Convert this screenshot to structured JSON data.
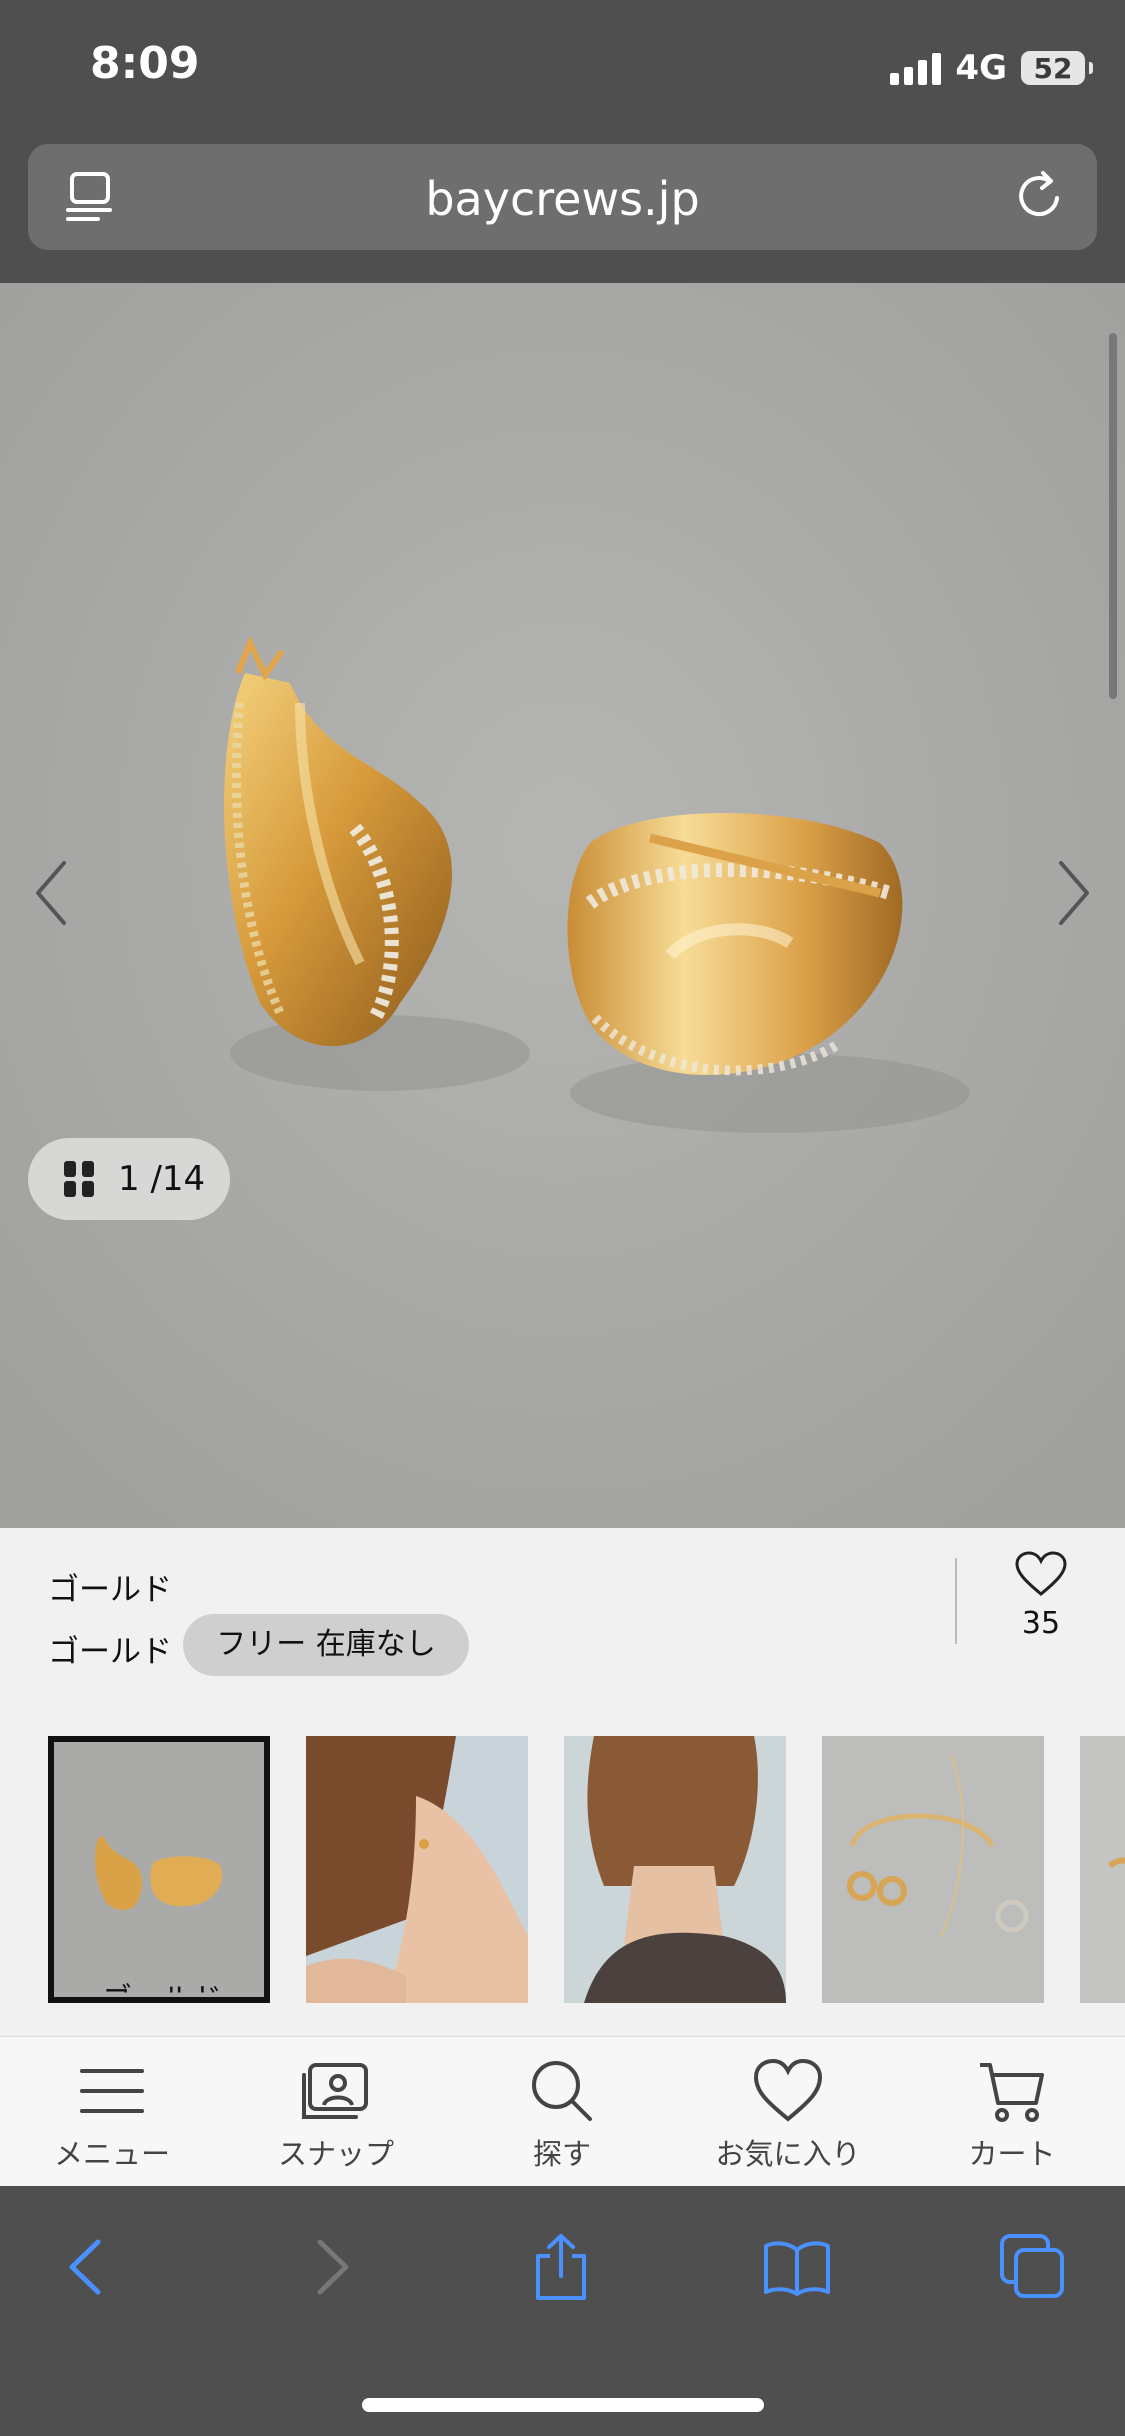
{
  "status_bar": {
    "time": "8:09",
    "network": "4G",
    "battery": "52"
  },
  "url_bar": {
    "domain": "baycrews.jp"
  },
  "gallery": {
    "counter": "1 /14"
  },
  "product": {
    "color_label": "ゴールド",
    "variant_color": "ゴールド",
    "size_stock": "フリー 在庫なし",
    "favorite_count": "35"
  },
  "thumbnails": {
    "selected_caption": "ゴールド"
  },
  "bottom_nav": {
    "menu": "メニュー",
    "snap": "スナップ",
    "search": "探す",
    "favorites": "お気に入り",
    "cart": "カート"
  },
  "colors": {
    "accent_blue": "#4a90ff",
    "chrome_gray": "#4f4f4f"
  }
}
